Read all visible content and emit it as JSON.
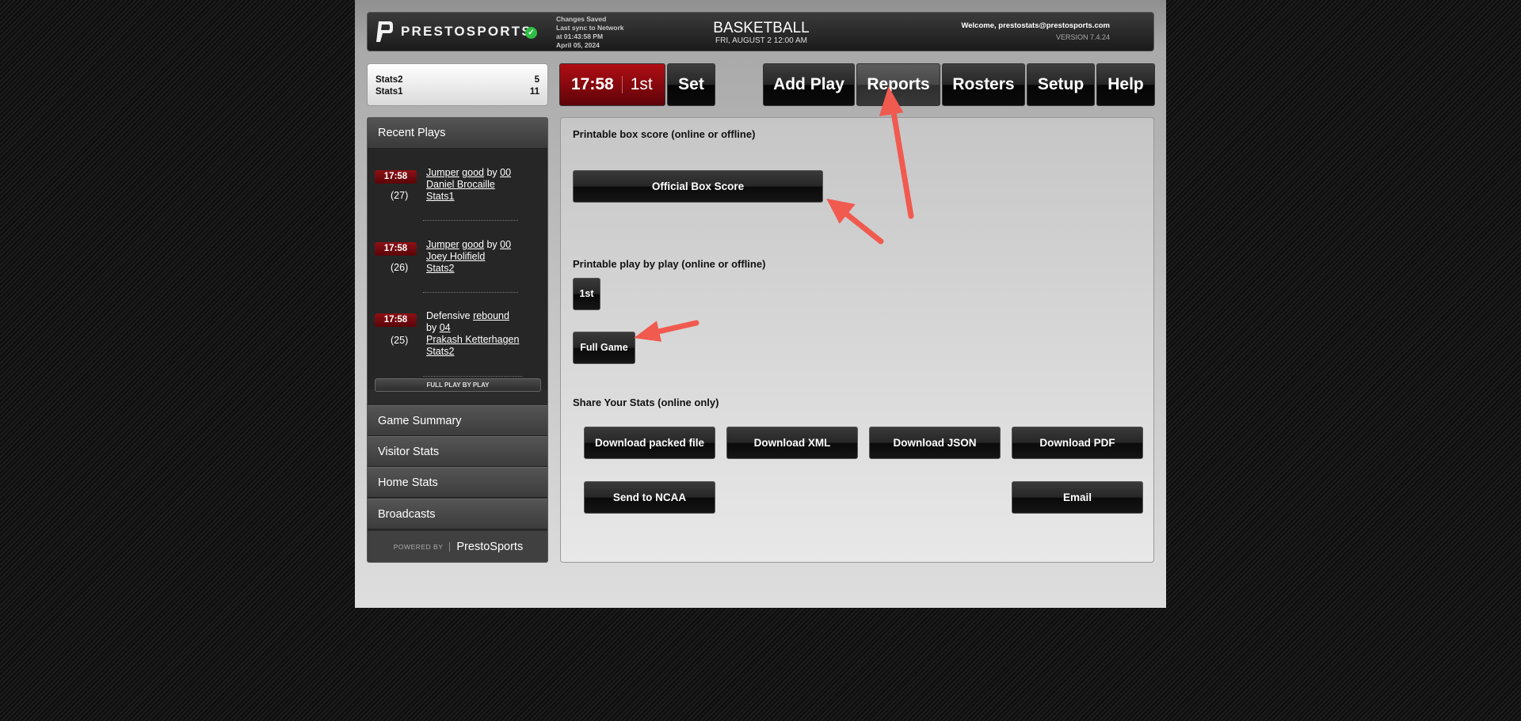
{
  "header": {
    "brand": "PRESTOSPORTS",
    "sync_lines": [
      "Changes Saved",
      "Last sync to Network",
      "at 01:43:58 PM",
      "April 05, 2024"
    ],
    "sport": "BASKETBALL",
    "game_date": "FRI, AUGUST 2 12:00 AM",
    "welcome": "Welcome, prestostats@prestosports.com",
    "version": "VERSION 7.4.24"
  },
  "scoreboard": {
    "teams": [
      {
        "name": "Stats2",
        "score": "5"
      },
      {
        "name": "Stats1",
        "score": "11"
      }
    ]
  },
  "clock": {
    "time": "17:58",
    "period": "1st",
    "set_label": "Set"
  },
  "nav": {
    "add_play": "Add Play",
    "reports": "Reports",
    "rosters": "Rosters",
    "setup": "Setup",
    "help": "Help"
  },
  "sidebar": {
    "recent_plays_title": "Recent Plays",
    "plays": [
      {
        "time": "17:58",
        "count": "(27)",
        "lines": [
          [
            "Jumper",
            " ",
            "good",
            " by ",
            "00"
          ],
          [
            "Daniel Brocaille"
          ],
          [
            "Stats1"
          ]
        ]
      },
      {
        "time": "17:58",
        "count": "(26)",
        "lines": [
          [
            "Jumper",
            " ",
            "good",
            " by ",
            "00"
          ],
          [
            "Joey Holifield"
          ],
          [
            "Stats2"
          ]
        ]
      },
      {
        "time": "17:58",
        "count": "(25)",
        "lines": [
          [
            "Defensive ",
            "rebound"
          ],
          [
            "by ",
            "04"
          ],
          [
            "Prakash Ketterhagen"
          ],
          [
            "Stats2"
          ]
        ]
      }
    ],
    "full_pbp": "FULL PLAY BY PLAY",
    "links": [
      "Game Summary",
      "Visitor Stats",
      "Home Stats",
      "Broadcasts"
    ],
    "powered_by": "POWERED BY",
    "powered_brand": "PrestoSports"
  },
  "reports": {
    "box_score_heading": "Printable box score (online or offline)",
    "official_box_score": "Official Box Score",
    "pbp_heading": "Printable play by play (online or offline)",
    "period_button": "1st",
    "full_game_button": "Full Game",
    "share_heading": "Share Your Stats (online only)",
    "download_packed": "Download packed file",
    "download_xml": "Download XML",
    "download_json": "Download JSON",
    "download_pdf": "Download PDF",
    "send_ncaa": "Send to NCAA",
    "email": "Email"
  },
  "colors": {
    "annotation_arrow": "#f15a4f",
    "clock_red": "#a00c12",
    "sync_check": "#2fbf45"
  }
}
